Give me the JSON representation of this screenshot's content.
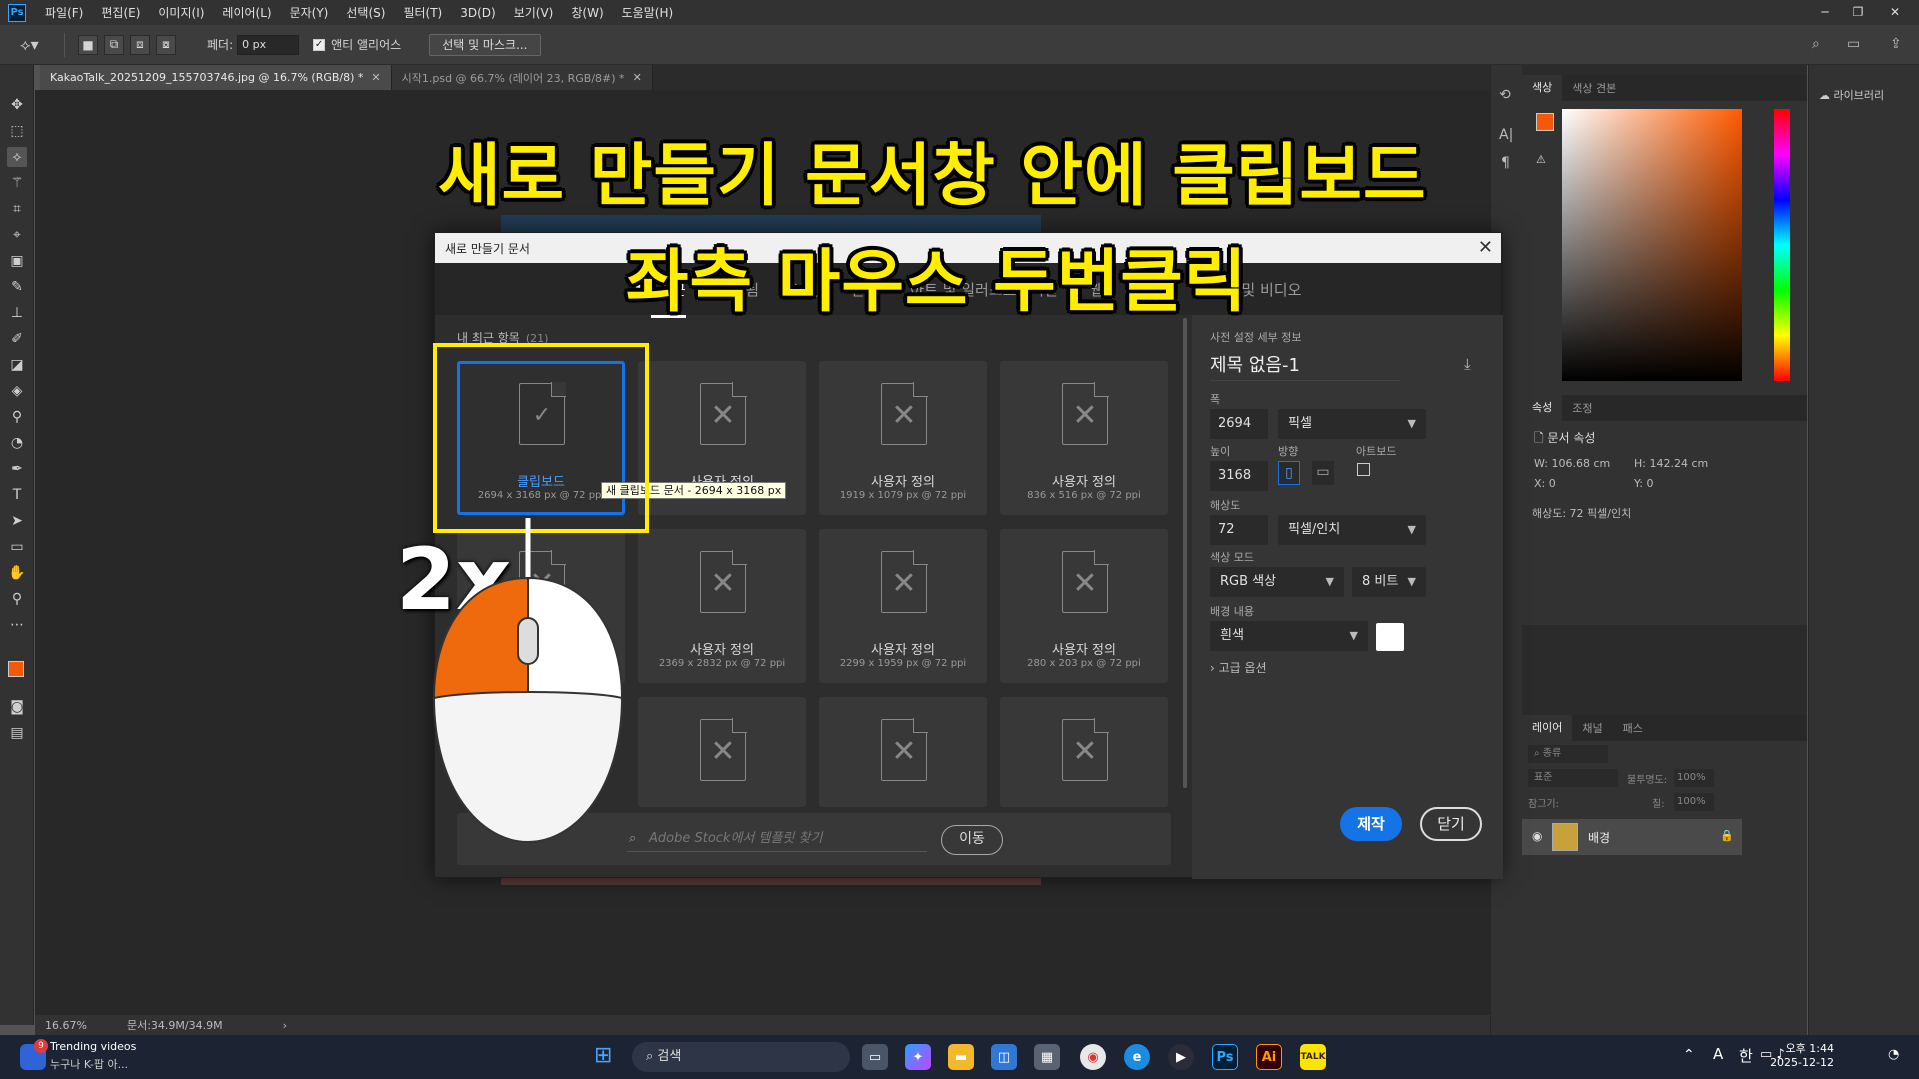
{
  "menubar": {
    "logo": "Ps",
    "items": [
      "파일(F)",
      "편집(E)",
      "이미지(I)",
      "레이어(L)",
      "문자(Y)",
      "선택(S)",
      "필터(T)",
      "3D(D)",
      "보기(V)",
      "창(W)",
      "도움말(H)"
    ],
    "minimize": "─",
    "restore": "❐",
    "close": "✕"
  },
  "options": {
    "feather_label": "페더:",
    "feather_value": "0 px",
    "antialias_label": "앤티 앨리어스",
    "antialias_checked": true,
    "select_mask_button": "선택 및 마스크..."
  },
  "tabs": [
    {
      "label": "KakaoTalk_20251209_155703746.jpg @ 16.7% (RGB/8) *",
      "active": true
    },
    {
      "label": "시작1.psd @ 66.7% (레이어 23, RGB/8#) *",
      "active": false
    }
  ],
  "status": {
    "zoom": "16.67%",
    "doc": "문서:34.9M/34.9M",
    "arrow": "›"
  },
  "overlay": {
    "caption_line1": "새로 만들기 문서창 안에 클립보드",
    "caption_line2": "좌측 마우스 두번클릭",
    "two_x": "2x"
  },
  "dialog": {
    "title": "새로 만들기 문서",
    "close": "✕",
    "categories": [
      "최근",
      "저장됨",
      "사진",
      "인쇄",
      "아트 및 일러스트레이션",
      "웹",
      "모바일",
      "영화 및 비디오"
    ],
    "active_category": "최근",
    "recent_label": "내 최근 항목",
    "recent_count": "(21)",
    "tiles": [
      {
        "name": "클립보드",
        "size": "2694 x 3168 px @ 72 ppi",
        "selected": true
      },
      {
        "name": "사용자 정의",
        "size": "",
        "selected": false
      },
      {
        "name": "사용자 정의",
        "size": "1919 x 1079 px @ 72 ppi",
        "selected": false
      },
      {
        "name": "사용자 정의",
        "size": "836 x 516 px @ 72 ppi",
        "selected": false
      },
      {
        "name": "",
        "size": "",
        "selected": false
      },
      {
        "name": "사용자 정의",
        "size": "2369 x 2832 px @ 72 ppi",
        "selected": false
      },
      {
        "name": "사용자 정의",
        "size": "2299 x 1959 px @ 72 ppi",
        "selected": false
      },
      {
        "name": "사용자 정의",
        "size": "280 x 203 px @ 72 ppi",
        "selected": false
      },
      {
        "name": "",
        "size": "",
        "selected": false
      },
      {
        "name": "",
        "size": "",
        "selected": false
      },
      {
        "name": "",
        "size": "",
        "selected": false
      }
    ],
    "tooltip": "새 클립보드 문서 - 2694 x 3168 px",
    "stock_placeholder": "Adobe Stock에서 템플릿 찾기",
    "stock_go": "이동",
    "detail": {
      "heading": "사전 설정 세부 정보",
      "doc_name": "제목 없음-1",
      "width_label": "폭",
      "width_value": "2694",
      "width_unit": "픽셀",
      "height_label": "높이",
      "height_value": "3168",
      "orientation_label": "방향",
      "artboard_label": "아트보드",
      "resolution_label": "해상도",
      "resolution_value": "72",
      "resolution_unit": "픽셀/인치",
      "color_mode_label": "색상 모드",
      "color_mode_value": "RGB 색상",
      "bit_depth": "8 비트",
      "bg_label": "배경 내용",
      "bg_value": "흰색",
      "advanced": "고급 옵션",
      "create": "제작",
      "close": "닫기"
    }
  },
  "panels": {
    "color_tabs": [
      "색상",
      "색상 견본"
    ],
    "properties_tabs": [
      "속성",
      "조정"
    ],
    "doc_props": "문서 속성",
    "w_label": "W:",
    "w_value": "106.68 cm",
    "h_label": "H:",
    "h_value": "142.24 cm",
    "x_label": "X:",
    "x_value": "0",
    "y_label": "Y:",
    "y_value": "0",
    "resolution_text": "해상도: 72 픽셀/인치",
    "layers_tabs": [
      "레이어",
      "채널",
      "패스"
    ],
    "layer_kind": "종류",
    "blend_mode": "표준",
    "opacity_label": "불투명도:",
    "opacity_value": "100%",
    "lock_label": "잠그기:",
    "fill_label": "칠:",
    "fill_value": "100%",
    "layer_name": "배경",
    "library": "라이브러리"
  },
  "taskbar": {
    "notif_count": "9",
    "trend_title": "Trending videos",
    "trend_sub": "누구나 K-팝 아...",
    "search": "검색",
    "time": "오후 1:44",
    "date": "2025-12-12",
    "ime_a": "A",
    "ime_han": "한"
  }
}
